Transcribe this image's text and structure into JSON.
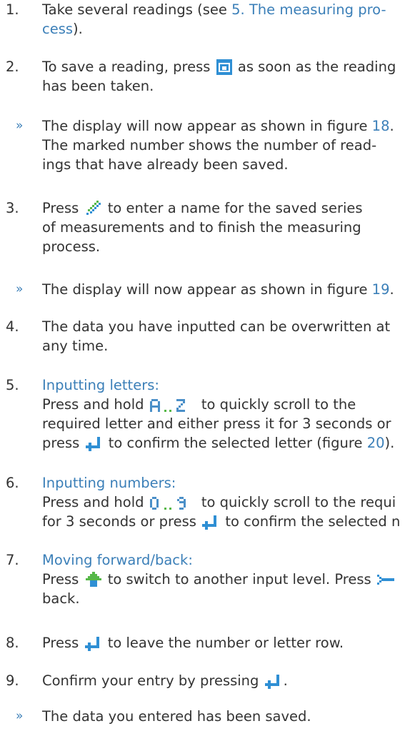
{
  "steps": [
    {
      "number": "1.",
      "text_before": "Take several readings (see ",
      "link": "5. The measuring pro-",
      "link_line2": "cess",
      "text_after": ")."
    },
    {
      "number": "2.",
      "line1_before": "To save a reading, press",
      "line1_after": "as soon as the reading",
      "line2": "has been taken.",
      "icon": "save-icon"
    },
    {
      "number": "3.",
      "line1_before": "Press",
      "line1_after": "to enter a name for the saved series",
      "line2": "of measurements and to finish the measuring",
      "line3": "process.",
      "icon": "pencil-icon"
    },
    {
      "number": "4.",
      "line1": "The data you have inputted can be overwritten at",
      "line2": "any time."
    },
    {
      "number": "5.",
      "heading": "Inputting letters:",
      "line1_before": "Press and hold",
      "line1_after": "to quickly scroll to the",
      "line2": "required letter and either press it for 3 seconds or",
      "line3_before": "press",
      "line3_mid": "to confirm the selected letter (figure ",
      "figure": "20",
      "line3_end": ").",
      "icons": [
        "a-to-z-icon",
        "enter-icon"
      ]
    },
    {
      "number": "6.",
      "heading": "Inputting numbers:",
      "line1_before": "Press and hold",
      "line1_after": "to quickly scroll to the requi",
      "line2_before": "for 3 seconds or press",
      "line2_after": "to confirm the selected n",
      "icons": [
        "zero-to-nine-icon",
        "enter-icon"
      ]
    },
    {
      "number": "7.",
      "heading": "Moving forward/back:",
      "line1_before": "Press",
      "line1_after": "to switch to another input level. Press",
      "line2": "back.",
      "icons": [
        "shift-up-icon",
        "back-icon"
      ]
    },
    {
      "number": "8.",
      "before": "Press",
      "after": "to leave the number or letter row.",
      "icon": "enter-icon"
    },
    {
      "number": "9.",
      "before": "Confirm your entry by pressing",
      "after": ".",
      "icon": "enter-icon"
    }
  ],
  "results": [
    {
      "marker": "»",
      "line1_before": "The display will now appear as shown in figure ",
      "figure": "18",
      "line1_after": ".",
      "line2": "The marked number shows the number of read-",
      "line3": "ings that have already been saved."
    },
    {
      "marker": "»",
      "before": "The display will now appear as shown in figure ",
      "figure": "19",
      "after": "."
    },
    {
      "marker": "»",
      "text": "The data you entered has been saved."
    }
  ],
  "colors": {
    "text": "#333333",
    "link": "#3b7fb8",
    "icon_blue": "#2f8fd4",
    "icon_green": "#56b848"
  }
}
